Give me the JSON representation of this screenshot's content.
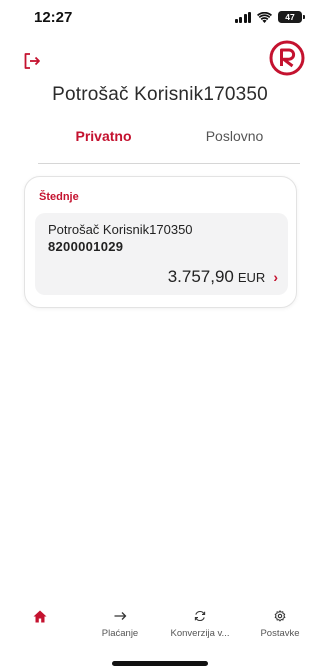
{
  "status_bar": {
    "time": "12:27",
    "battery": "47"
  },
  "header": {
    "user_name": "Potrošač Korisnik170350",
    "logout_icon": "logout-icon",
    "logo_icon": "brand-r-logo"
  },
  "tabs": [
    {
      "label": "Privatno",
      "active": true
    },
    {
      "label": "Poslovno",
      "active": false
    }
  ],
  "savings": {
    "title": "Štednje",
    "account": {
      "holder": "Potrošač Korisnik170350",
      "number": "8200001029",
      "amount": "3.757,90",
      "currency": "EUR"
    }
  },
  "bottom_nav": [
    {
      "label": "",
      "icon": "home-icon",
      "active": true
    },
    {
      "label": "Plaćanje",
      "icon": "arrow-right-icon"
    },
    {
      "label": "Konverzija v...",
      "icon": "refresh-icon"
    },
    {
      "label": "Postavke",
      "icon": "gear-icon"
    }
  ],
  "colors": {
    "accent": "#c4122f",
    "text": "#222222",
    "card_inner": "#f3f3f4"
  }
}
